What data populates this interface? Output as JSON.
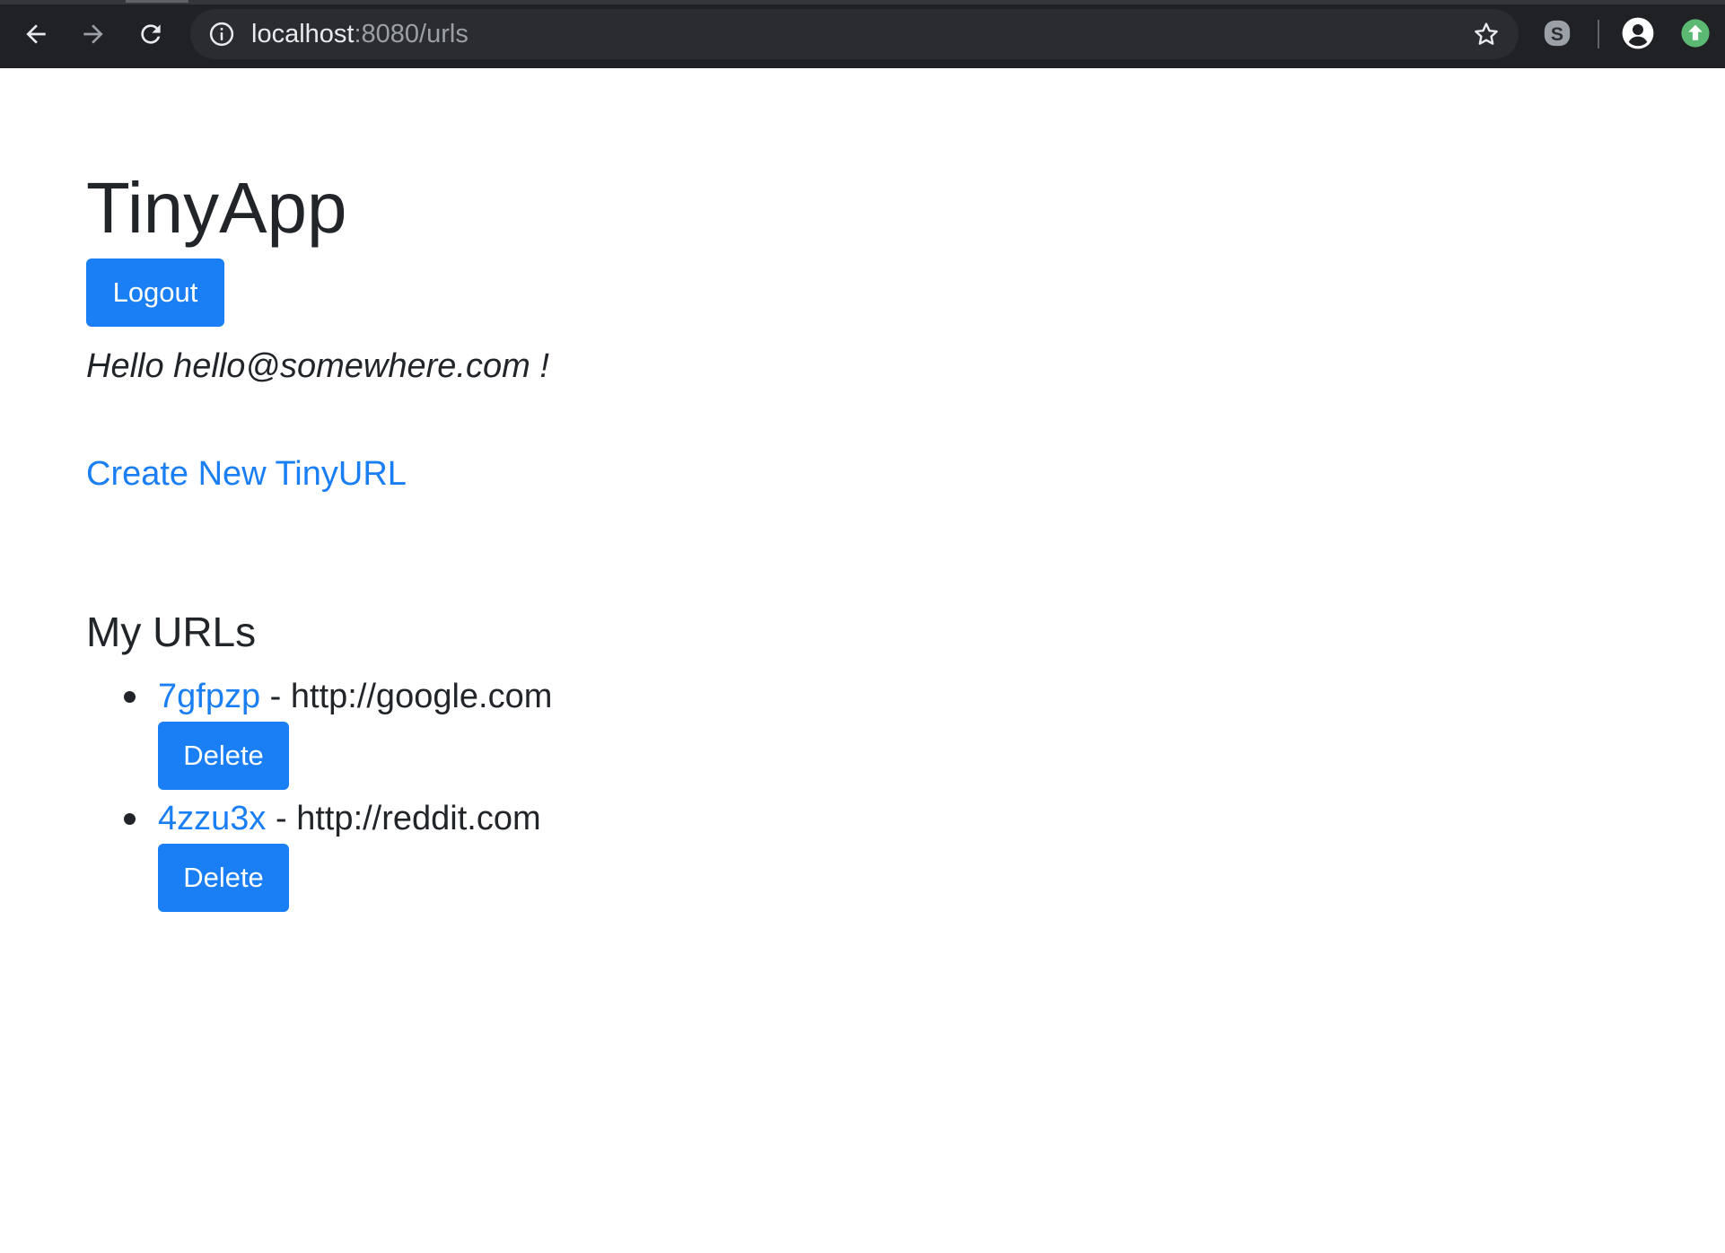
{
  "browser": {
    "url_host": "localhost",
    "url_rest": ":8080/urls",
    "icons": {
      "back": "arrow-left-icon",
      "forward": "arrow-right-icon",
      "reload": "reload-icon",
      "site_info": "info-icon",
      "bookmark": "star-icon",
      "extension": "skype-icon",
      "profile": "account-icon",
      "update": "update-arrow-icon"
    },
    "colors": {
      "chrome_bg": "#202124",
      "omnibox_bg": "#2b2c2f",
      "update": "#5bb974"
    }
  },
  "page": {
    "title": "TinyApp",
    "logout_label": "Logout",
    "greeting": "Hello hello@somewhere.com !",
    "create_link": "Create New TinyURL",
    "section_title": "My URLs",
    "separator": " - ",
    "delete_label": "Delete",
    "urls": [
      {
        "short": "7gfpzp",
        "long": "http://google.com"
      },
      {
        "short": "4zzu3x",
        "long": "http://reddit.com"
      }
    ],
    "colors": {
      "primary": "#1a7ff5",
      "text": "#212529"
    }
  }
}
